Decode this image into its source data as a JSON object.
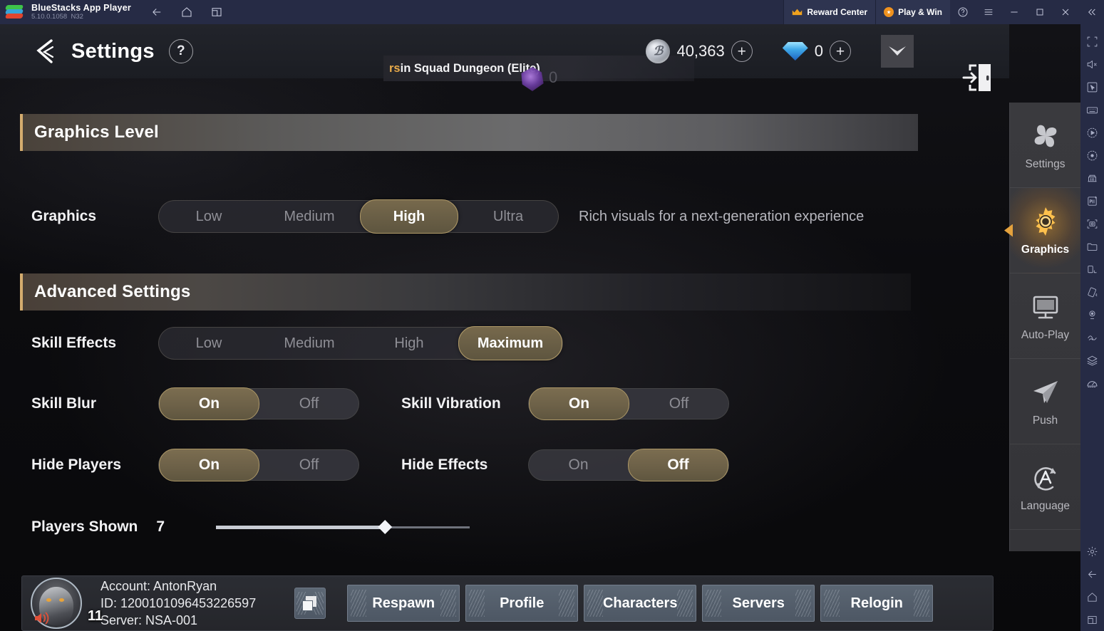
{
  "titlebar": {
    "app_name": "BlueStacks App Player",
    "version": "5.10.0.1058",
    "build": "N32",
    "nav": [
      {
        "name": "back-icon",
        "label": "Back"
      },
      {
        "name": "home-icon",
        "label": "Home"
      },
      {
        "name": "recents-icon",
        "label": "Recents"
      }
    ],
    "reward_center": "Reward Center",
    "play_and_win": "Play & Win",
    "help": "?",
    "menu": "☰",
    "minimize": "—",
    "maximize": "□",
    "close": "×",
    "collapse": "«"
  },
  "game_header": {
    "title": "Settings",
    "help_label": "?",
    "notification": {
      "prefix": "rs",
      "text": " in Squad Dungeon (Elite)",
      "zero": "0"
    },
    "currency": {
      "coin_glyph": "ℬ",
      "coin_value": "40,363",
      "coin_plus": "+",
      "gem_value": "0",
      "gem_plus": "+"
    }
  },
  "sections": {
    "graphics_level": "Graphics Level",
    "advanced_settings": "Advanced Settings"
  },
  "graphics_row": {
    "label": "Graphics",
    "options": [
      "Low",
      "Medium",
      "High",
      "Ultra"
    ],
    "selected": "High",
    "description": "Rich visuals for a next-generation experience"
  },
  "skill_effects_row": {
    "label": "Skill Effects",
    "options": [
      "Low",
      "Medium",
      "High",
      "Maximum"
    ],
    "selected": "Maximum"
  },
  "toggles": [
    {
      "label": "Skill Blur",
      "on": "On",
      "off": "Off",
      "selected": "On"
    },
    {
      "label": "Skill Vibration",
      "on": "On",
      "off": "Off",
      "selected": "On"
    },
    {
      "label": "Hide Players",
      "on": "On",
      "off": "Off",
      "selected": "On"
    },
    {
      "label": "Hide Effects",
      "on": "On",
      "off": "Off",
      "selected": "Off"
    }
  ],
  "slider": {
    "label": "Players Shown",
    "value": "7",
    "percent": 66
  },
  "account": {
    "name_line": "Account: AntonRyan",
    "id_line": "ID: 1200101096453226597",
    "server_line": "Server: NSA-001",
    "level": "11",
    "buttons": [
      "Respawn",
      "Profile",
      "Characters",
      "Servers",
      "Relogin"
    ]
  },
  "game_rail": [
    {
      "label": "Settings",
      "icon": "pinwheel-icon",
      "active": false
    },
    {
      "label": "Graphics",
      "icon": "gear-icon",
      "active": true
    },
    {
      "label": "Auto-Play",
      "icon": "monitor-icon",
      "active": false
    },
    {
      "label": "Push",
      "icon": "paper-plane-icon",
      "active": false
    },
    {
      "label": "Language",
      "icon": "language-icon",
      "active": false
    }
  ],
  "bs_toolbar": [
    "fullscreen-icon",
    "mute-icon",
    "cursor-icon",
    "keyboard-icon",
    "macro-icon",
    "record-icon",
    "multi-instance-icon",
    "apk-install-icon",
    "screenshot-icon",
    "media-folder-icon",
    "rotate-icon",
    "tilt-icon",
    "location-icon",
    "shake-icon",
    "layers-icon",
    "performance-icon"
  ],
  "bs_toolbar_bottom": [
    "settings-gear-icon",
    "back-arrow-icon",
    "home-icon",
    "recents-icon"
  ],
  "colors": {
    "accent_gold": "#d4ac6e",
    "selected_pill": "#6a5f46",
    "titlebar_bg": "#262b45",
    "panel_bg": "#2b2d33"
  }
}
